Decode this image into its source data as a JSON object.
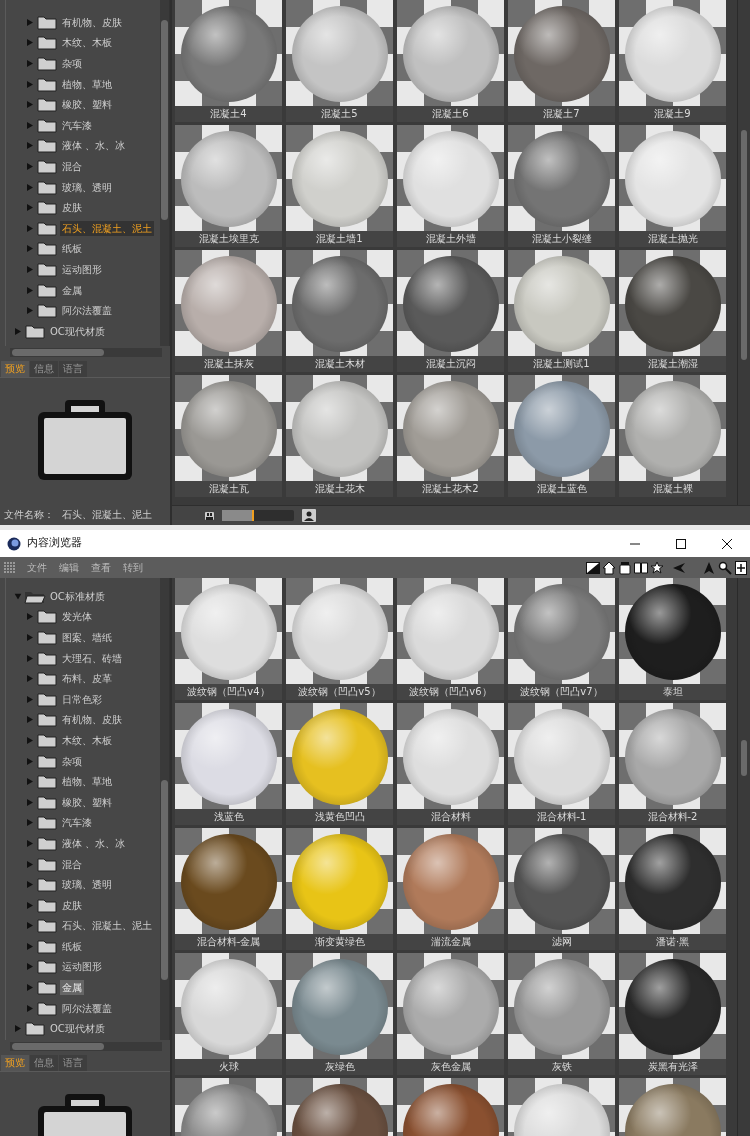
{
  "top_window": {
    "tree": {
      "focused": true,
      "items": [
        {
          "children": [
            {
              "label": "有机物、皮肤",
              "expanded": false,
              "selected": false
            },
            {
              "label": "木纹、木板",
              "expanded": false,
              "selected": false
            },
            {
              "label": "杂项",
              "expanded": false,
              "selected": false
            },
            {
              "label": "植物、草地",
              "expanded": false,
              "selected": false
            },
            {
              "label": "橡胶、塑料",
              "expanded": false,
              "selected": false
            },
            {
              "label": "汽车漆",
              "expanded": false,
              "selected": false
            },
            {
              "label": "液体 、水、冰",
              "expanded": false,
              "selected": false
            },
            {
              "label": "混合",
              "expanded": false,
              "selected": false
            },
            {
              "label": "玻璃、透明",
              "expanded": false,
              "selected": false
            },
            {
              "label": "皮肤",
              "expanded": false,
              "selected": false
            },
            {
              "label": "石头、混凝土、泥土",
              "expanded": false,
              "selected": true
            },
            {
              "label": "纸板",
              "expanded": false,
              "selected": false
            },
            {
              "label": "运动图形",
              "expanded": false,
              "selected": false
            },
            {
              "label": "金属",
              "expanded": false,
              "selected": false
            },
            {
              "label": "阿尔法覆盖",
              "expanded": false,
              "selected": false
            }
          ]
        },
        {
          "label": "OC现代材质",
          "expanded": false,
          "selected": false
        }
      ]
    },
    "preview_tabs": [
      {
        "label": "预览",
        "selected": true
      },
      {
        "label": "信息",
        "selected": false
      },
      {
        "label": "语言",
        "selected": false
      }
    ],
    "filename_label": "文件名称：",
    "filename": "石头、混凝土、泥土",
    "materials": [
      {
        "label": "混凝土4",
        "color": "#787878"
      },
      {
        "label": "混凝土5",
        "color": "#c4c4c4"
      },
      {
        "label": "混凝土6",
        "color": "#c0c0c0"
      },
      {
        "label": "混凝土7",
        "color": "#6e6864"
      },
      {
        "label": "混凝土9",
        "color": "#dcdcdc"
      },
      {
        "label": "混凝土埃里克",
        "color": "#bcbcbc"
      },
      {
        "label": "混凝土墙1",
        "color": "#d0d0cc"
      },
      {
        "label": "混凝土外墙",
        "color": "#e0e0e0"
      },
      {
        "label": "混凝土小裂缝",
        "color": "#747474"
      },
      {
        "label": "混凝土抛光",
        "color": "#e4e4e4"
      },
      {
        "label": "混凝土抹灰",
        "color": "#b8aeaa"
      },
      {
        "label": "混凝土木材",
        "color": "#6c6c6c"
      },
      {
        "label": "混凝土沉闷",
        "color": "#5a5a5a"
      },
      {
        "label": "混凝土测试1",
        "color": "#c8c8c0"
      },
      {
        "label": "混凝土潮湿",
        "color": "#4a4844"
      },
      {
        "label": "混凝土瓦",
        "color": "#9a9894"
      },
      {
        "label": "混凝土花木",
        "color": "#c4c4c2"
      },
      {
        "label": "混凝土花木2",
        "color": "#a09c96"
      },
      {
        "label": "混凝土蓝色",
        "color": "#8c9aa8"
      },
      {
        "label": "混凝土裸",
        "color": "#b0b0ae"
      }
    ],
    "zoom": {
      "level": 0.45
    }
  },
  "bottom_window": {
    "title": "内容浏览器",
    "menus": [
      "文件",
      "编辑",
      "查看",
      "转到"
    ],
    "tree": {
      "focused": false,
      "items": [
        {
          "label": "OC标准材质",
          "expanded": true,
          "selected": false,
          "children": [
            {
              "label": "发光体",
              "expanded": false,
              "selected": false
            },
            {
              "label": "图案、墙纸",
              "expanded": false,
              "selected": false
            },
            {
              "label": "大理石、砖墙",
              "expanded": false,
              "selected": false
            },
            {
              "label": "布料、皮革",
              "expanded": false,
              "selected": false
            },
            {
              "label": "日常色彩",
              "expanded": false,
              "selected": false
            },
            {
              "label": "有机物、皮肤",
              "expanded": false,
              "selected": false
            },
            {
              "label": "木纹、木板",
              "expanded": false,
              "selected": false
            },
            {
              "label": "杂项",
              "expanded": false,
              "selected": false
            },
            {
              "label": "植物、草地",
              "expanded": false,
              "selected": false
            },
            {
              "label": "橡胶、塑料",
              "expanded": false,
              "selected": false
            },
            {
              "label": "汽车漆",
              "expanded": false,
              "selected": false
            },
            {
              "label": "液体 、水、冰",
              "expanded": false,
              "selected": false
            },
            {
              "label": "混合",
              "expanded": false,
              "selected": false
            },
            {
              "label": "玻璃、透明",
              "expanded": false,
              "selected": false
            },
            {
              "label": "皮肤",
              "expanded": false,
              "selected": false
            },
            {
              "label": "石头、混凝土、泥土",
              "expanded": false,
              "selected": false
            },
            {
              "label": "纸板",
              "expanded": false,
              "selected": false
            },
            {
              "label": "运动图形",
              "expanded": false,
              "selected": false
            },
            {
              "label": "金属",
              "expanded": false,
              "selected": true
            },
            {
              "label": "阿尔法覆盖",
              "expanded": false,
              "selected": false
            }
          ]
        },
        {
          "label": "OC现代材质",
          "expanded": false,
          "selected": false
        }
      ]
    },
    "preview_tabs": [
      {
        "label": "预览",
        "selected": true
      },
      {
        "label": "信息",
        "selected": false
      },
      {
        "label": "语言",
        "selected": false
      }
    ],
    "materials": [
      {
        "label": "波纹钢（凹凸v4）",
        "color": "#dedede"
      },
      {
        "label": "波纹钢（凹凸v5）",
        "color": "#dcdcdc"
      },
      {
        "label": "波纹钢（凹凸v6）",
        "color": "#dadada"
      },
      {
        "label": "波纹钢（凹凸v7）",
        "color": "#7a7a7a"
      },
      {
        "label": "泰坦",
        "color": "#1e1e1e"
      },
      {
        "label": "浅蓝色",
        "color": "#dcdce4"
      },
      {
        "label": "浅黄色凹凸",
        "color": "#e6c020"
      },
      {
        "label": "混合材料",
        "color": "#dedede"
      },
      {
        "label": "混合材料-1",
        "color": "#dcdcdc"
      },
      {
        "label": "混合材料-2",
        "color": "#a8a8a8"
      },
      {
        "label": "混合材料-金属",
        "color": "#6a4a1e"
      },
      {
        "label": "渐变黄绿色",
        "color": "#e8c416"
      },
      {
        "label": "湍流金属",
        "color": "#b07a5a"
      },
      {
        "label": "滤网",
        "color": "#555555"
      },
      {
        "label": "潘诺·黑",
        "color": "#2e2e2e"
      },
      {
        "label": "火球",
        "color": "#d8d8d8"
      },
      {
        "label": "灰绿色",
        "color": "#7a8a90"
      },
      {
        "label": "灰色金属",
        "color": "#ababab"
      },
      {
        "label": "灰铁",
        "color": "#9a9a9a"
      },
      {
        "label": "炭黑有光泽",
        "color": "#2a2a2a"
      },
      {
        "color": "#8a8a8a"
      },
      {
        "color": "#6a5040"
      },
      {
        "color": "#8a5030"
      },
      {
        "color": "#dcdcdc"
      },
      {
        "color": "#8a7a60"
      }
    ]
  }
}
